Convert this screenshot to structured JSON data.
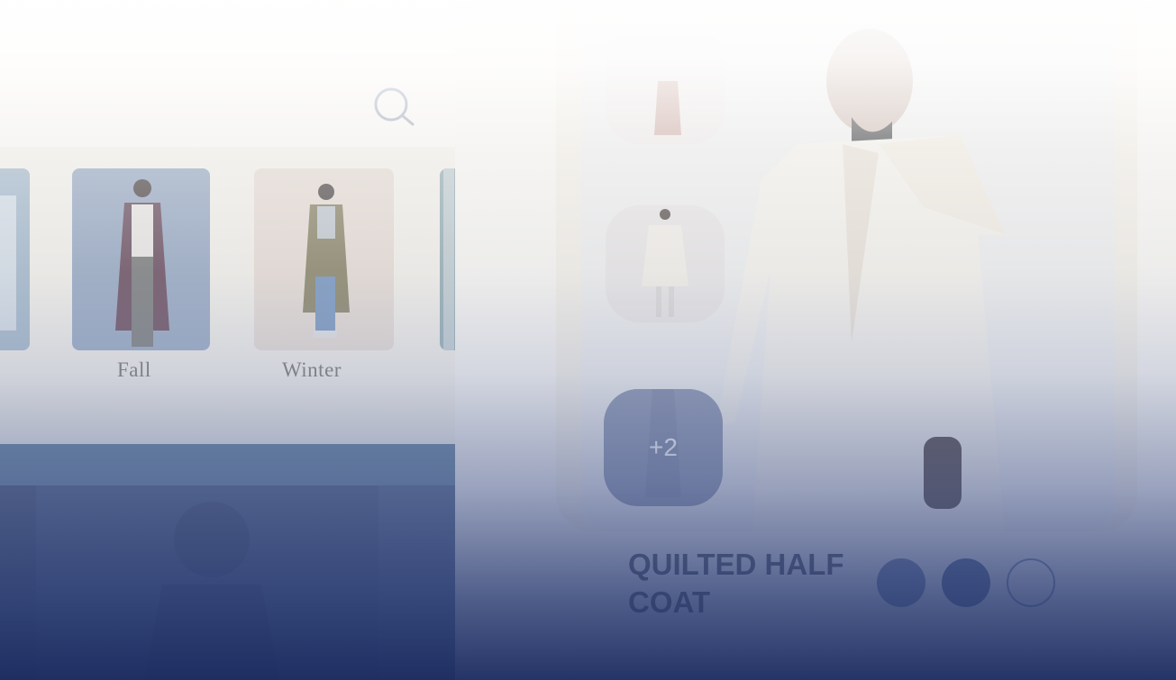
{
  "left_app": {
    "categories": [
      {
        "label": ""
      },
      {
        "label": "Fall"
      },
      {
        "label": "Winter"
      },
      {
        "label": ""
      }
    ]
  },
  "product": {
    "name": "QUILTED HALF COAT",
    "more_images_label": "+2",
    "swatches": [
      "#5e6f98",
      "#3d4f7c",
      "#e9e9ee"
    ]
  },
  "icons": {
    "search": "search-icon"
  },
  "colors": {
    "accent_blue": "#4f6f8d",
    "overlay_navy": "#1e2e62"
  }
}
